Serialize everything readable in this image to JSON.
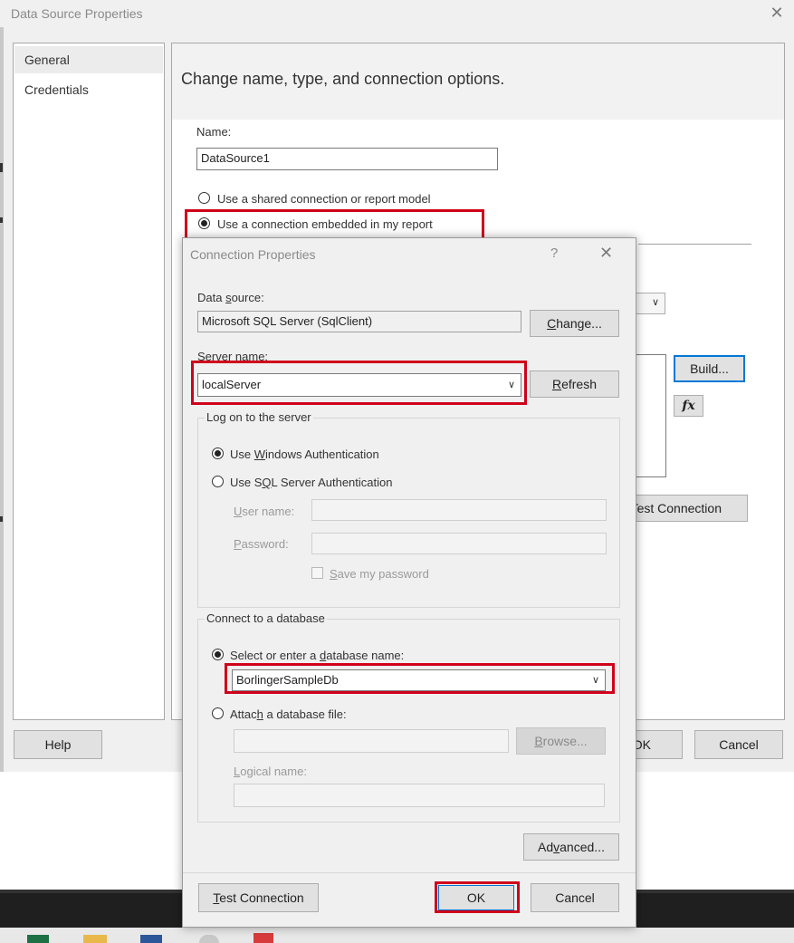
{
  "outer_window": {
    "title": "Data Source Properties",
    "close_glyph": "✕",
    "nav": [
      "General",
      "Credentials"
    ],
    "header_text": "Change name, type, and connection options.",
    "name_label": "Name:",
    "name_value": "DataSource1",
    "radio_shared": "Use a shared connection or report model",
    "radio_embedded": "Use a connection embedded in my report",
    "build_button": "Build...",
    "fx_button": "fx",
    "test_connection_button": "Test Connection",
    "help_button": "Help",
    "ok_button": "OK",
    "cancel_button": "Cancel"
  },
  "connection_dialog": {
    "title": "Connection Properties",
    "help_glyph": "?",
    "close_glyph": "✕",
    "data_source_label": {
      "pre": "Data ",
      "u": "s",
      "post": "ource:"
    },
    "data_source_value": "Microsoft SQL Server (SqlClient)",
    "change_button": {
      "pre": "",
      "u": "C",
      "post": "hange..."
    },
    "server_name_label": {
      "pre": "Ser",
      "u": "v",
      "post": "er name:"
    },
    "server_name_value": "localServer",
    "refresh_button": {
      "pre": "",
      "u": "R",
      "post": "efresh"
    },
    "logon_group_title": "Log on to the server",
    "windows_auth": {
      "pre": "Use ",
      "u": "W",
      "post": "indows Authentication"
    },
    "sql_auth": {
      "pre": "Use S",
      "u": "Q",
      "post": "L Server Authentication"
    },
    "user_name_label": {
      "pre": "",
      "u": "U",
      "post": "ser name:"
    },
    "password_label": {
      "pre": "",
      "u": "P",
      "post": "assword:"
    },
    "save_password": {
      "pre": "",
      "u": "S",
      "post": "ave my password"
    },
    "db_group_title": "Connect to a database",
    "select_db": {
      "pre": "Select or enter a ",
      "u": "d",
      "post": "atabase name:"
    },
    "db_name_value": "BorlingerSampleDb",
    "attach_db": {
      "pre": "Attac",
      "u": "h",
      "post": " a database file:"
    },
    "browse_button": {
      "pre": "",
      "u": "B",
      "post": "rowse..."
    },
    "logical_name_label": {
      "pre": "",
      "u": "L",
      "post": "ogical name:"
    },
    "advanced_button": {
      "pre": "Ad",
      "u": "v",
      "post": "anced..."
    },
    "test_connection_button": {
      "pre": "",
      "u": "T",
      "post": "est Connection"
    },
    "ok_button": "OK",
    "cancel_button": "Cancel"
  },
  "colors": {
    "highlight_box": "#d0021b",
    "dialog_bg": "#f0f0f0",
    "button_bg": "#e1e1e1",
    "focus_border": "#0078d7"
  }
}
